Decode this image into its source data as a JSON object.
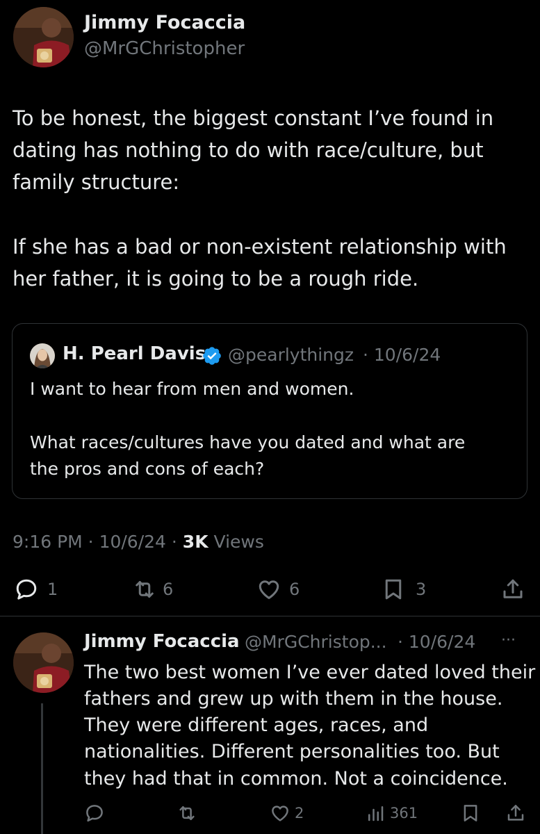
{
  "main_tweet": {
    "author_name": "Jimmy Focaccia",
    "author_handle": "@MrGChristopher",
    "text_line1": "To be honest, the biggest constant I’ve found in",
    "text_line2": "dating has nothing to do with race/culture, but",
    "text_line3": "family structure:",
    "text_line4": "If she has a bad or non-existent relationship with",
    "text_line5": "her father, it is going to be a rough ride.",
    "time": "9:16 PM · 10/6/24 · ",
    "views_count": "3K",
    "views_label": " Views",
    "replies": "1",
    "retweets": "6",
    "likes": "6",
    "bookmarks": "3"
  },
  "quoted_tweet": {
    "author_name": "H. Pearl Davis",
    "author_handle": "@pearlythingz",
    "date": "· 10/6/24",
    "text_line1": "I want to hear from men and women.",
    "text_line2": "What races/cultures have you dated and what are",
    "text_line3": "the pros and cons of each?"
  },
  "reply_tweet": {
    "author_name": "Jimmy Focaccia",
    "author_handle": "@MrGChristop...",
    "date": "· 10/6/24",
    "more": "···",
    "text_line1": "The two best women I’ve ever dated loved their",
    "text_line2": "fathers and grew up with them in the house.",
    "text_line3": "They were different ages, races, and",
    "text_line4": "nationalities. Different personalities too. But",
    "text_line5": "they had that in common. Not a coincidence.",
    "likes": "2",
    "views": "361"
  },
  "colors": {
    "background": "#000000",
    "text": "#e7e9ea",
    "muted": "#71767b",
    "verified": "#1d9bf0",
    "border": "#2f3336"
  }
}
